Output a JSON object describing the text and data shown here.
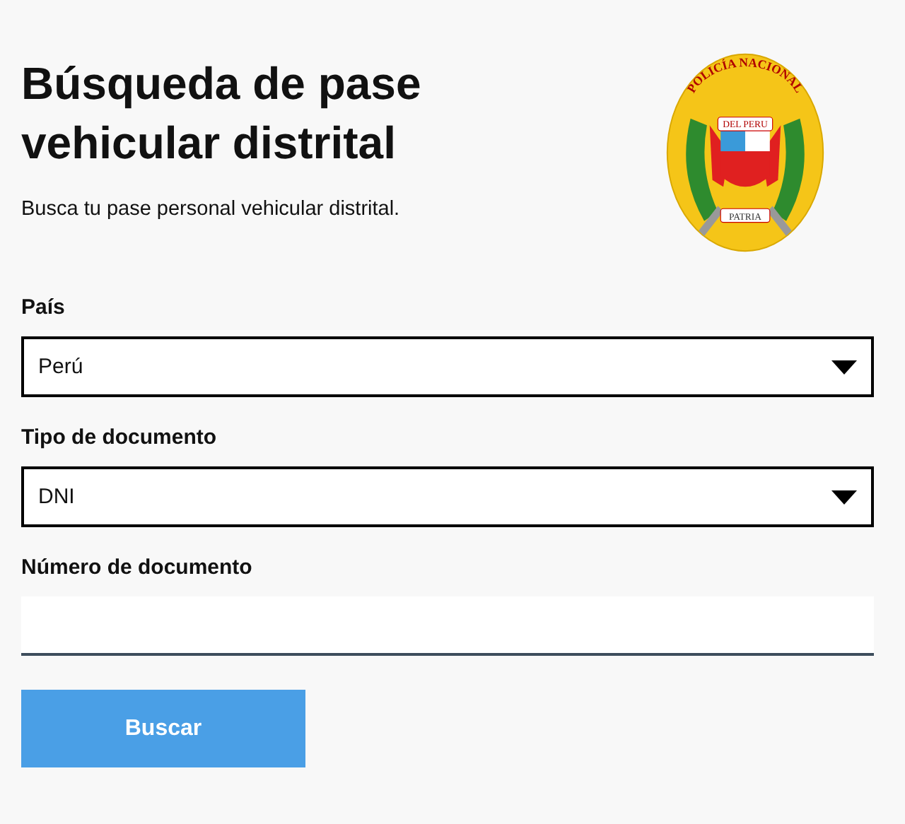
{
  "header": {
    "title": "Búsqueda de pase vehicular distrital",
    "subtitle": "Busca tu pase personal vehicular distrital."
  },
  "emblem": {
    "top_text": "POLICÍA NACIONAL",
    "ribbon_text": "DEL PERU",
    "bottom_text": "PATRIA"
  },
  "fields": [
    {
      "kind": "select",
      "label": "País",
      "value": "Perú"
    },
    {
      "kind": "select",
      "label": "Tipo de documento",
      "value": "DNI"
    },
    {
      "kind": "text",
      "label": "Número de documento"
    }
  ],
  "buttons": [
    {
      "label": "Buscar"
    }
  ]
}
